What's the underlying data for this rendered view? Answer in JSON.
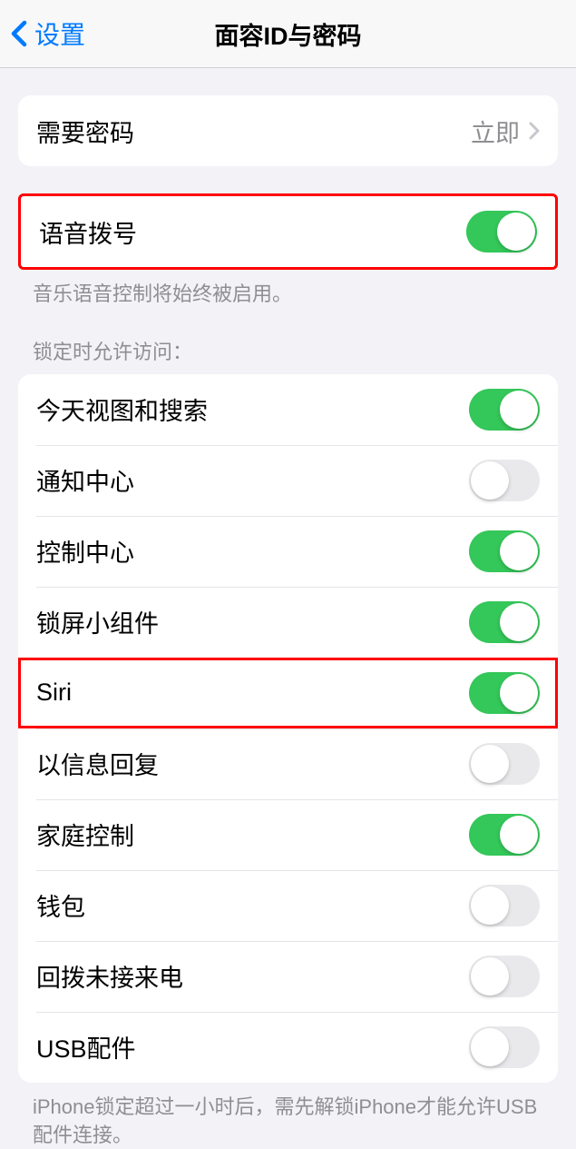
{
  "header": {
    "back_label": "设置",
    "title": "面容ID与密码"
  },
  "require_passcode": {
    "label": "需要密码",
    "value": "立即"
  },
  "voice_dial": {
    "label": "语音拨号",
    "on": true,
    "footer": "音乐语音控制将始终被启用。"
  },
  "lock_access": {
    "header": "锁定时允许访问：",
    "items": [
      {
        "label": "今天视图和搜索",
        "on": true
      },
      {
        "label": "通知中心",
        "on": false
      },
      {
        "label": "控制中心",
        "on": true
      },
      {
        "label": "锁屏小组件",
        "on": true
      },
      {
        "label": "Siri",
        "on": true
      },
      {
        "label": "以信息回复",
        "on": false
      },
      {
        "label": "家庭控制",
        "on": true
      },
      {
        "label": "钱包",
        "on": false
      },
      {
        "label": "回拨未接来电",
        "on": false
      },
      {
        "label": "USB配件",
        "on": false
      }
    ],
    "footer": "iPhone锁定超过一小时后，需先解锁iPhone才能允许USB配件连接。"
  }
}
